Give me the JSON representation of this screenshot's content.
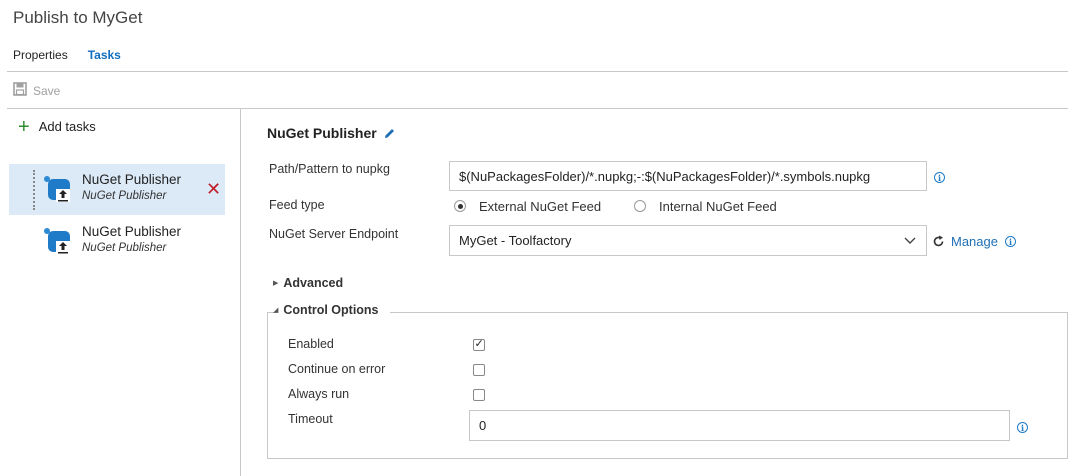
{
  "window": {
    "title": "Publish to MyGet"
  },
  "tabs": [
    {
      "label": "Properties",
      "active": false
    },
    {
      "label": "Tasks",
      "active": true
    }
  ],
  "toolbar": {
    "save_label": "Save",
    "save_icon": "save-icon"
  },
  "left": {
    "add_tasks_label": "Add tasks",
    "tasks": [
      {
        "name": "NuGet Publisher",
        "subtitle": "NuGet Publisher",
        "selected": true
      },
      {
        "name": "NuGet Publisher",
        "subtitle": "NuGet Publisher",
        "selected": false
      }
    ]
  },
  "detail": {
    "heading": "NuGet Publisher",
    "path_label": "Path/Pattern to nupkg",
    "path_value": "$(NuPackagesFolder)/*.nupkg;-:$(NuPackagesFolder)/*.symbols.nupkg",
    "feed_type_label": "Feed type",
    "feed_options": [
      {
        "label": "External NuGet Feed",
        "selected": true
      },
      {
        "label": "Internal NuGet Feed",
        "selected": false
      }
    ],
    "endpoint_label": "NuGet Server Endpoint",
    "endpoint_value": "MyGet - Toolfactory",
    "manage_label": "Manage",
    "advanced_label": "Advanced",
    "control_options_label": "Control Options",
    "enabled_label": "Enabled",
    "enabled": true,
    "continue_label": "Continue on error",
    "continue_on_error": false,
    "always_run_label": "Always run",
    "always_run": false,
    "timeout_label": "Timeout",
    "timeout_value": "0"
  },
  "colors": {
    "accent": "#106ebe",
    "selected_bg": "#dceaf7",
    "remove": "#c0202b",
    "add": "#2e8b2e"
  }
}
